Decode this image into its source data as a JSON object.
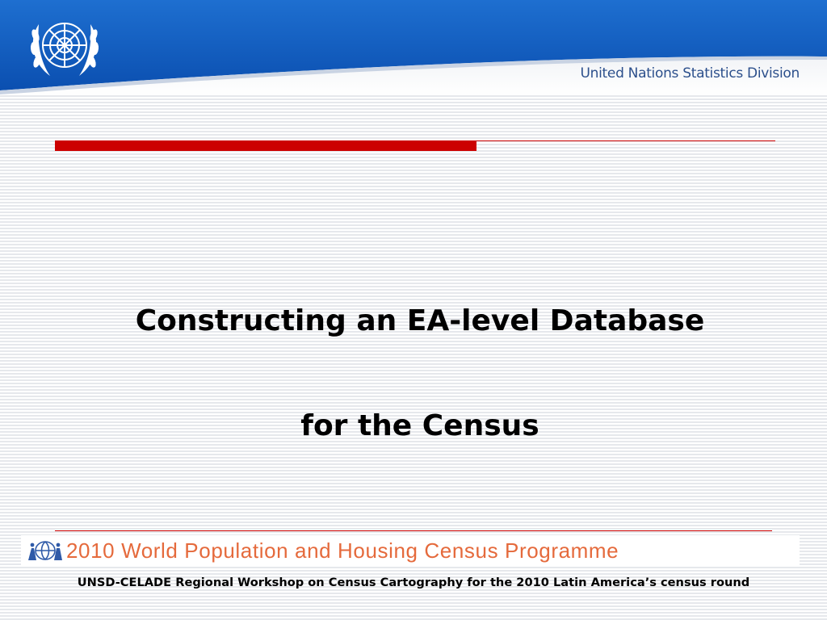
{
  "header": {
    "organization": "United Nations Statistics Division",
    "logo_icon": "un-emblem-icon",
    "colors": {
      "banner": "#1565c0",
      "banner_dark": "#0d47a1",
      "org_text": "#2c4f8c"
    }
  },
  "accent": {
    "color": "#cc0000"
  },
  "title": {
    "line1": "Constructing an EA-level Database",
    "line2": "for the Census"
  },
  "programme": {
    "text": "2010 World Population and Housing Census Programme",
    "icon": "globe-figures-icon",
    "color": "#e56a3c"
  },
  "footer": {
    "text": "UNSD-CELADE Regional Workshop on Census Cartography for the 2010 Latin America’s census round"
  }
}
